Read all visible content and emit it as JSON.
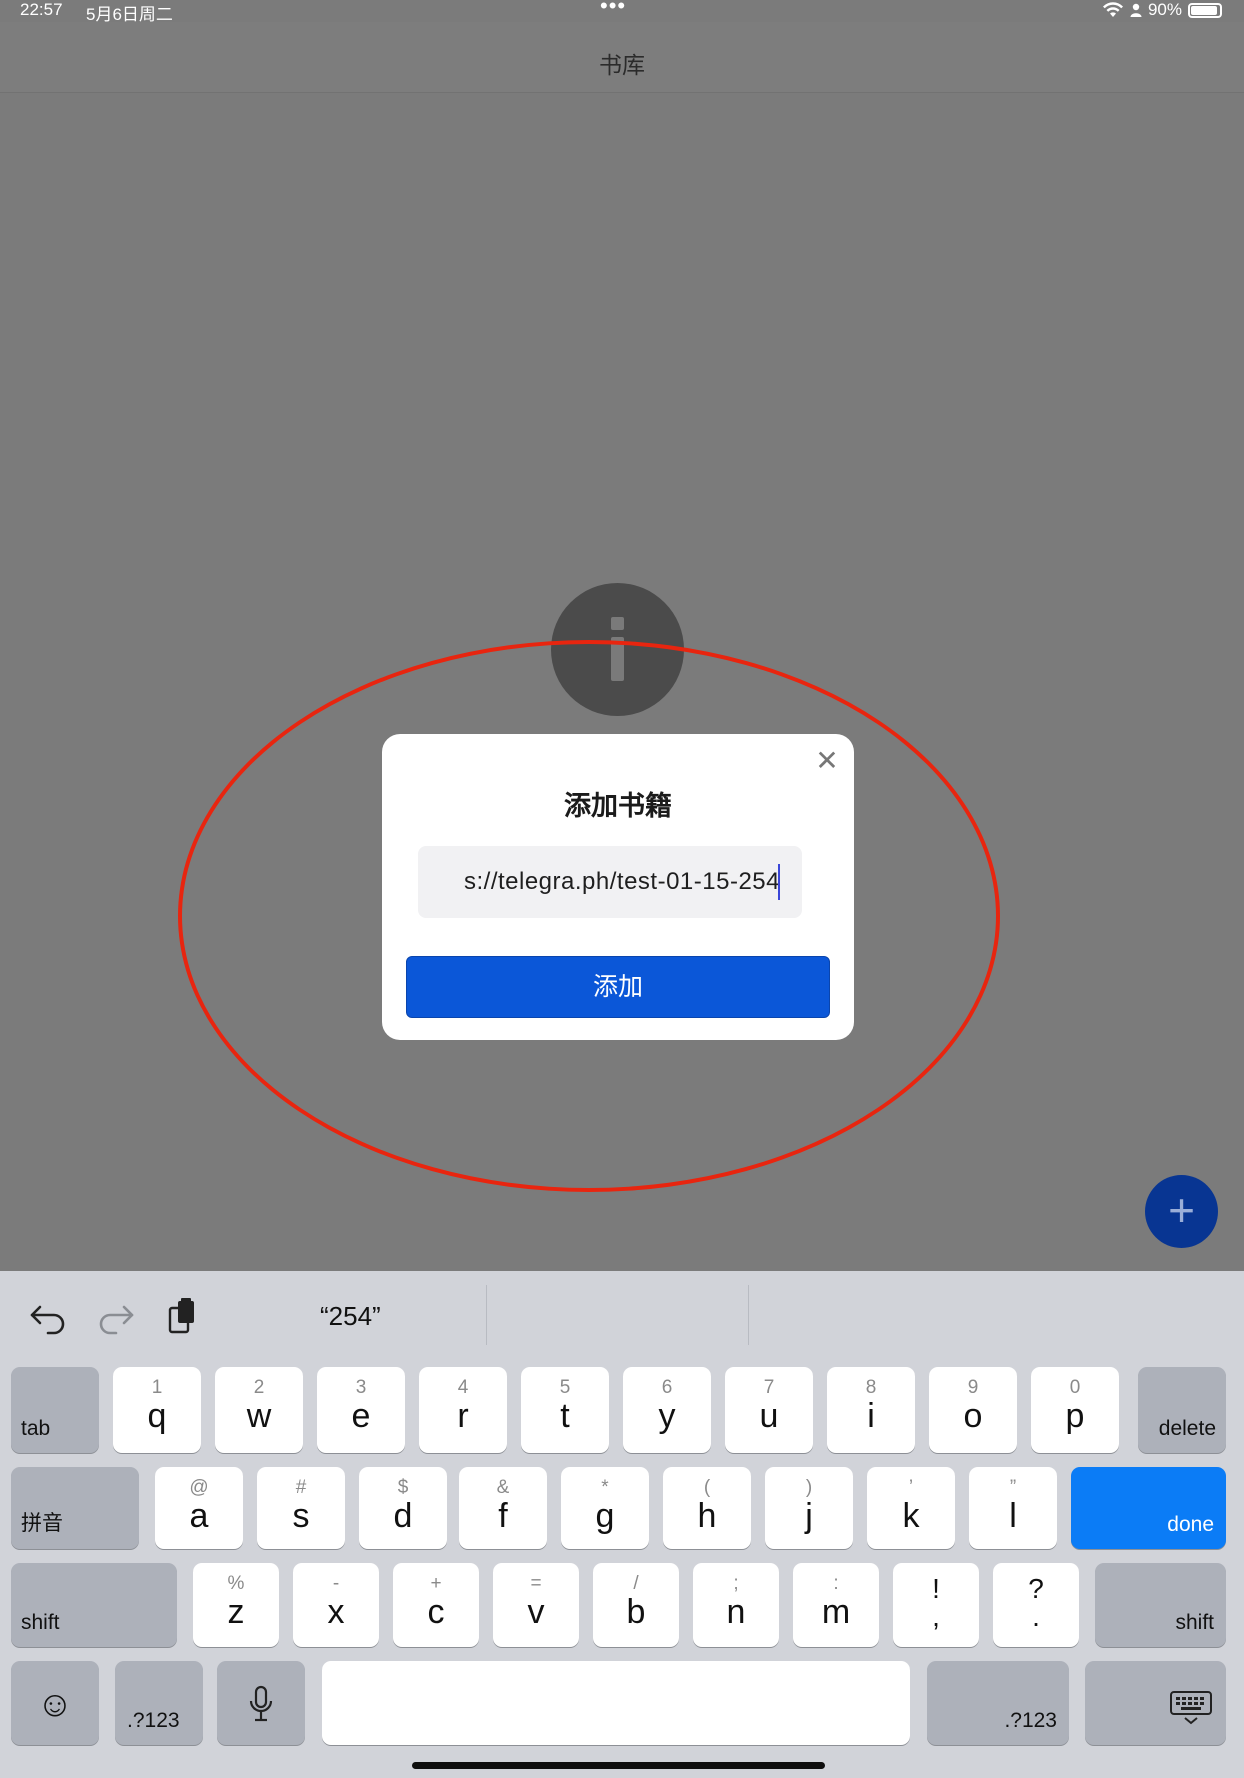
{
  "status_bar": {
    "time": "22:57",
    "date": "5月6日周二",
    "battery": "90%",
    "battery_level": 0.9,
    "dots": "•••"
  },
  "nav": {
    "title": "书库"
  },
  "dialog": {
    "title": "添加书籍",
    "url_value": "s://telegra.ph/test-01-15-254",
    "add_label": "添加",
    "close_glyph": "✕"
  },
  "fab": {
    "glyph": "+"
  },
  "keyboard": {
    "suggestion": "“254”",
    "row1": [
      {
        "hint": "1",
        "key": "q"
      },
      {
        "hint": "2",
        "key": "w"
      },
      {
        "hint": "3",
        "key": "e"
      },
      {
        "hint": "4",
        "key": "r"
      },
      {
        "hint": "5",
        "key": "t"
      },
      {
        "hint": "6",
        "key": "y"
      },
      {
        "hint": "7",
        "key": "u"
      },
      {
        "hint": "8",
        "key": "i"
      },
      {
        "hint": "9",
        "key": "o"
      },
      {
        "hint": "0",
        "key": "p"
      }
    ],
    "row2": [
      {
        "hint": "@",
        "key": "a"
      },
      {
        "hint": "#",
        "key": "s"
      },
      {
        "hint": "$",
        "key": "d"
      },
      {
        "hint": "&",
        "key": "f"
      },
      {
        "hint": "*",
        "key": "g"
      },
      {
        "hint": "(",
        "key": "h"
      },
      {
        "hint": ")",
        "key": "j"
      },
      {
        "hint": "’",
        "key": "k"
      },
      {
        "hint": "”",
        "key": "l"
      }
    ],
    "row3": [
      {
        "hint": "%",
        "key": "z"
      },
      {
        "hint": "-",
        "key": "x"
      },
      {
        "hint": "+",
        "key": "c"
      },
      {
        "hint": "=",
        "key": "v"
      },
      {
        "hint": "/",
        "key": "b"
      },
      {
        "hint": ";",
        "key": "n"
      },
      {
        "hint": ":",
        "key": "m"
      }
    ],
    "punct": [
      {
        "top": "!",
        "bottom": ","
      },
      {
        "top": "?",
        "bottom": "."
      }
    ],
    "tab": "tab",
    "delete": "delete",
    "pinyin": "拼音",
    "done": "done",
    "shift": "shift",
    "num": ".?123",
    "emoji_glyph": "☺",
    "mic_glyph": "🎤",
    "hide_glyph": "⌨"
  }
}
